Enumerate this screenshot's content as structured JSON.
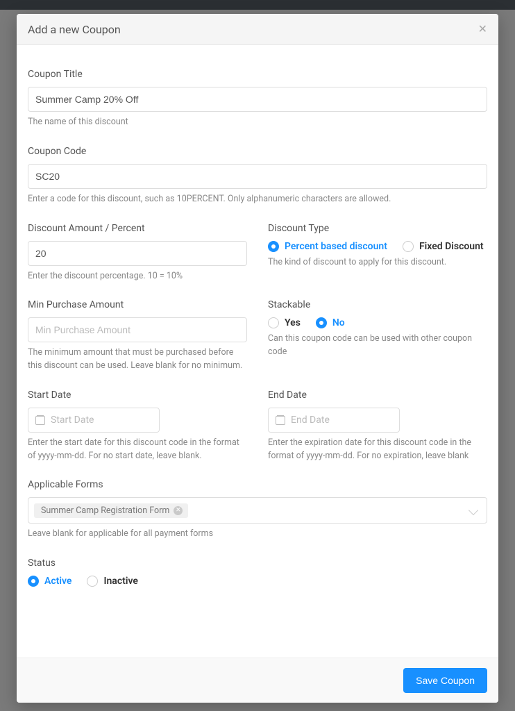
{
  "modal": {
    "title": "Add a new Coupon"
  },
  "couponTitle": {
    "label": "Coupon Title",
    "value": "Summer Camp 20% Off",
    "help": "The name of this discount"
  },
  "couponCode": {
    "label": "Coupon Code",
    "value": "SC20",
    "help": "Enter a code for this discount, such as 10PERCENT. Only alphanumeric characters are allowed."
  },
  "discountAmount": {
    "label": "Discount Amount / Percent",
    "value": "20",
    "help": "Enter the discount percentage. 10 = 10%"
  },
  "discountType": {
    "label": "Discount Type",
    "options": {
      "percent": "Percent based discount",
      "fixed": "Fixed Discount"
    },
    "selected": "percent",
    "help": "The kind of discount to apply for this discount."
  },
  "minPurchase": {
    "label": "Min Purchase Amount",
    "placeholder": "Min Purchase Amount",
    "help": "The minimum amount that must be purchased before this discount can be used. Leave blank for no minimum."
  },
  "stackable": {
    "label": "Stackable",
    "options": {
      "yes": "Yes",
      "no": "No"
    },
    "selected": "no",
    "help": "Can this coupon code can be used with other coupon code"
  },
  "startDate": {
    "label": "Start Date",
    "placeholder": "Start Date",
    "help": "Enter the start date for this discount code in the format of yyyy-mm-dd. For no start date, leave blank."
  },
  "endDate": {
    "label": "End Date",
    "placeholder": "End Date",
    "help": "Enter the expiration date for this discount code in the format of yyyy-mm-dd. For no expiration, leave blank"
  },
  "applicableForms": {
    "label": "Applicable Forms",
    "tag": "Summer Camp Registration Form",
    "help": "Leave blank for applicable for all payment forms"
  },
  "status": {
    "label": "Status",
    "options": {
      "active": "Active",
      "inactive": "Inactive"
    },
    "selected": "active"
  },
  "footer": {
    "save": "Save Coupon"
  }
}
